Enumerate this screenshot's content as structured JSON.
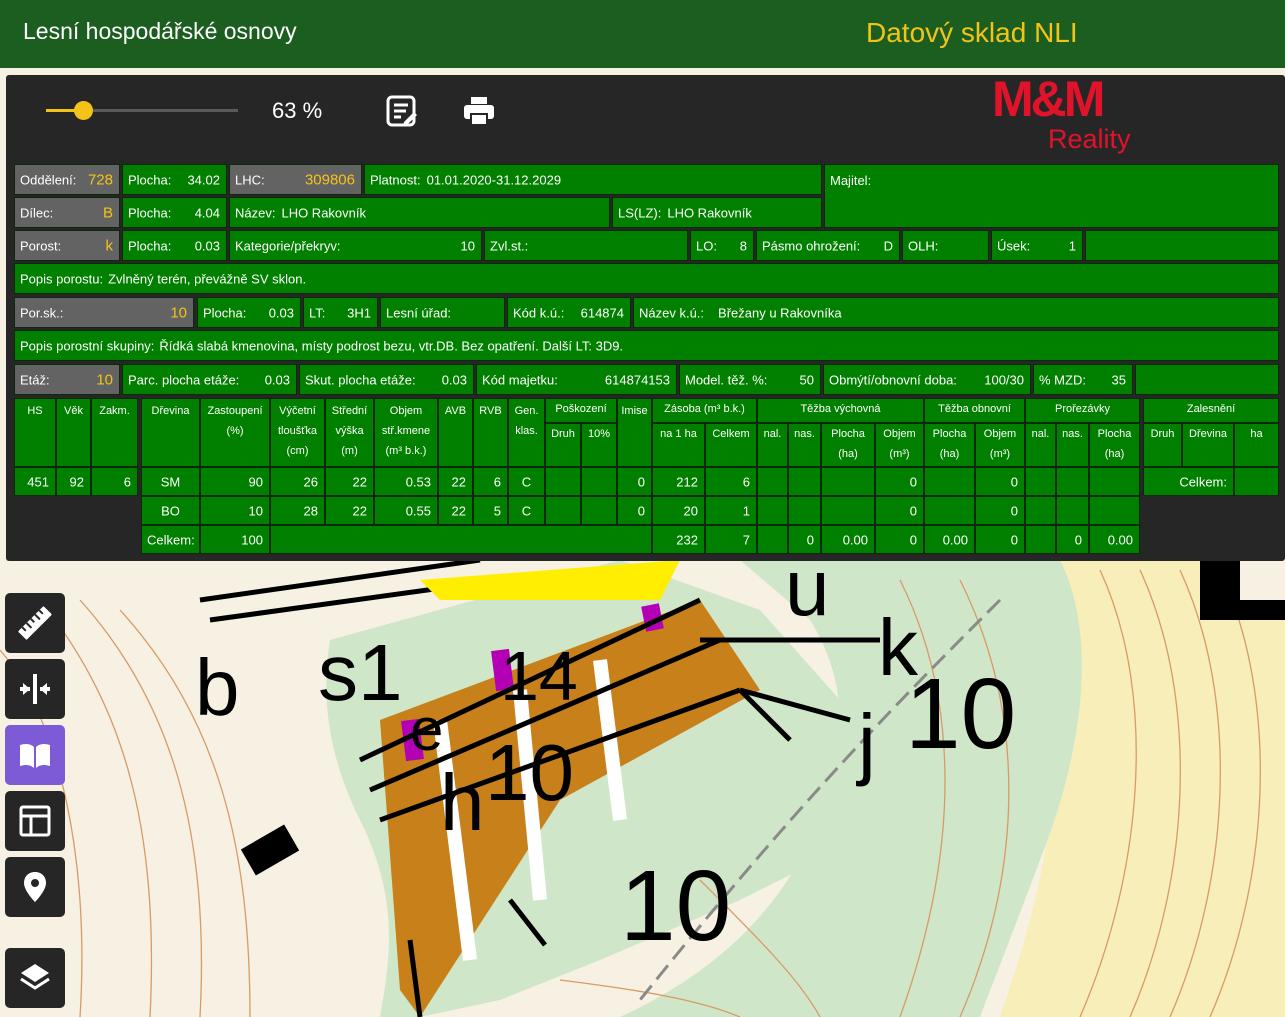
{
  "app": {
    "title": "Lesní hospodářské osnovy",
    "subtitle": "Datový sklad NLI"
  },
  "toolbar": {
    "zoom_value": "63 %",
    "zoom_fraction": 0.63,
    "icons": [
      "notes-icon",
      "print-icon"
    ]
  },
  "logo": {
    "main": "M&M",
    "sub": "Reality"
  },
  "info": {
    "row1": {
      "oddeleni_label": "Oddělení:",
      "oddeleni": "728",
      "plocha_label": "Plocha:",
      "plocha": "34.02",
      "lhc_label": "LHC:",
      "lhc": "309806",
      "platnost_label": "Platnost:",
      "platnost": "01.01.2020-31.12.2029",
      "majitel_label": "Majitel:"
    },
    "row2": {
      "dilec_label": "Dílec:",
      "dilec": "B",
      "plocha_label": "Plocha:",
      "plocha": "4.04",
      "nazev_label": "Název:",
      "nazev": "LHO Rakovník",
      "lslz_label": "LS(LZ):",
      "lslz": "LHO Rakovník"
    },
    "row3": {
      "porost_label": "Porost:",
      "porost": "k",
      "plocha_label": "Plocha:",
      "plocha": "0.03",
      "kategorie_label": "Kategorie/překryv:",
      "kategorie": "10",
      "zvlst_label": "Zvl.st.:",
      "lo_label": "LO:",
      "lo": "8",
      "pasmo_label": "Pásmo ohrožení:",
      "pasmo": "D",
      "olh_label": "OLH:",
      "usek_label": "Úsek:",
      "usek": "1"
    },
    "row4": {
      "label": "Popis porostu:",
      "value": "Zvlněný terén, převážně SV sklon."
    },
    "row5": {
      "porsk_label": "Por.sk.:",
      "porsk": "10",
      "plocha_label": "Plocha:",
      "plocha": "0.03",
      "lt_label": "LT:",
      "lt": "3H1",
      "urad_label": "Lesní úřad:",
      "kodku_label": "Kód k.ú.:",
      "kodku": "614874",
      "nazevku_label": "Název k.ú.:",
      "nazevku": "Břežany u Rakovníka"
    },
    "row6": {
      "label": "Popis porostní skupiny:",
      "value": "Řídká slabá kmenovina, místy podrost bezu, vtr.DB. Bez opatření. Další LT: 3D9."
    },
    "row7": {
      "etaz_label": "Etáž:",
      "etaz": "10",
      "parc_label": "Parc. plocha etáže:",
      "parc": "0.03",
      "skut_label": "Skut. plocha etáže:",
      "skut": "0.03",
      "kodmaj_label": "Kód majetku:",
      "kodmaj": "614874153",
      "model_label": "Model. těž. %:",
      "model": "50",
      "obmyti_label": "Obmýtí/obnovní doba:",
      "obmyti": "100/30",
      "mzd_label": "% MZD:",
      "mzd": "35"
    }
  },
  "left_table": {
    "headers": [
      "HS",
      "Věk",
      "Zakm."
    ],
    "values": [
      "451",
      "92",
      "6"
    ]
  },
  "main_table": {
    "h": {
      "drevina": "Dřevina",
      "zastoupeni": "Zastoupení",
      "zastoupeni_unit": "(%)",
      "tloustka1": "Výčetní",
      "tloustka2": "tloušťka",
      "tloustka3": "(cm)",
      "vyska1": "Střední",
      "vyska2": "výška",
      "vyska3": "(m)",
      "objem1": "Objem",
      "objem2": "stř.kmene",
      "objem3": "(m³ b.k.)",
      "avb": "AVB",
      "rvb": "RVB",
      "gen1": "Gen.",
      "gen2": "klas.",
      "poskozeni": "Poškození",
      "druh": "Druh",
      "p10": "10%",
      "imise": "Imise",
      "zasoba": "Zásoba (m³ b.k.)",
      "na1ha": "na 1 ha",
      "celkem": "Celkem",
      "tv": "Těžba výchovná",
      "nal": "nal.",
      "nas": "nas.",
      "plocha1": "Plocha",
      "plocha2": "(ha)",
      "objemv1": "Objem",
      "objemv2": "(m³)",
      "to": "Těžba obnovní",
      "pro": "Prořezávky"
    },
    "rows": [
      {
        "drevina": "SM",
        "zast": "90",
        "tl": "26",
        "vys": "22",
        "obj": "0.53",
        "avb": "22",
        "rvb": "6",
        "gen": "C",
        "imise": "0",
        "ha": "212",
        "cel": "6",
        "tv_obj": "0",
        "to_obj": "0"
      },
      {
        "drevina": "BO",
        "zast": "10",
        "tl": "28",
        "vys": "22",
        "obj": "0.55",
        "avb": "22",
        "rvb": "5",
        "gen": "C",
        "imise": "0",
        "ha": "20",
        "cel": "1",
        "tv_obj": "0",
        "to_obj": "0"
      }
    ],
    "total": {
      "label": "Celkem:",
      "zast": "100",
      "ha": "232",
      "cel": "7",
      "tv_nas": "0",
      "tv_plocha": "0.00",
      "tv_obj": "0",
      "to_plocha": "0.00",
      "to_obj": "0",
      "pro_nas": "0",
      "pro_plocha": "0.00"
    }
  },
  "right_table": {
    "title": "Zalesnění",
    "druh": "Druh",
    "drevina": "Dřevina",
    "ha": "ha",
    "total_label": "Celkem:"
  },
  "map_labels": {
    "b": "b",
    "s1": "s1",
    "u": "u",
    "k": "k",
    "j": "j",
    "ten_a": "10",
    "ten_b": "10",
    "e": "e",
    "h": "h",
    "ten_c": "10",
    "fourteen": "14"
  },
  "side_icons": [
    "ruler-icon",
    "split-icon",
    "book-icon",
    "layout-icon",
    "location-icon",
    "layers-icon"
  ]
}
